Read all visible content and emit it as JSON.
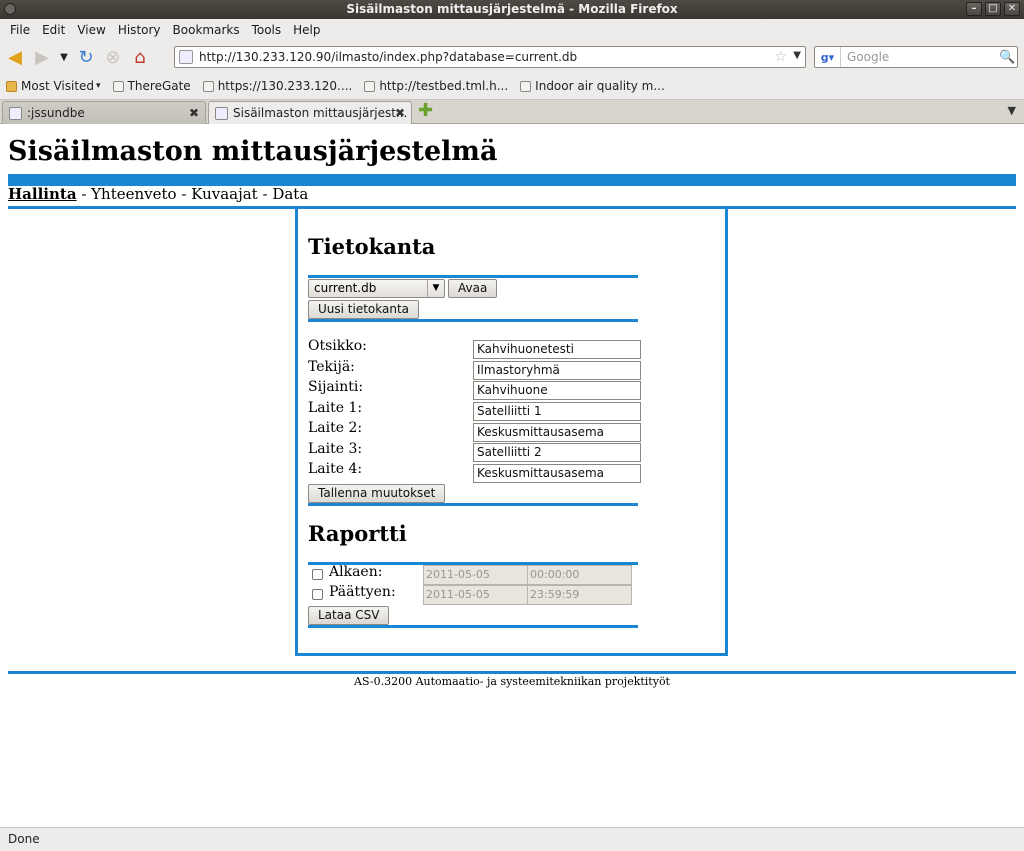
{
  "window": {
    "title": "Sisäilmaston mittausjärjestelmä - Mozilla Firefox"
  },
  "menu": [
    "File",
    "Edit",
    "View",
    "History",
    "Bookmarks",
    "Tools",
    "Help"
  ],
  "navigation": {
    "url": "http://130.233.120.90/ilmasto/index.php?database=current.db",
    "search_placeholder": "Google"
  },
  "bookmarks": [
    "Most Visited",
    "ThereGate",
    "https://130.233.120....",
    "http://testbed.tml.h...",
    "Indoor air quality m..."
  ],
  "tabs": [
    {
      "label": ":jssundbe"
    },
    {
      "label": "Sisäilmaston mittausjärjest..."
    }
  ],
  "page": {
    "title": "Sisäilmaston mittausjärjestelmä",
    "nav": {
      "current": "Hallinta",
      "items": [
        "Yhteenveto",
        "Kuvaajat",
        "Data"
      ],
      "separator": " - "
    },
    "database": {
      "heading": "Tietokanta",
      "selected": "current.db",
      "open_button": "Avaa",
      "new_button": "Uusi tietokanta"
    },
    "fields": [
      {
        "label": "Otsikko:",
        "value": "Kahvihuonetesti"
      },
      {
        "label": "Tekijä:",
        "value": "Ilmastoryhmä"
      },
      {
        "label": "Sijainti:",
        "value": "Kahvihuone"
      },
      {
        "label": "Laite 1:",
        "value": "Satelliitti 1"
      },
      {
        "label": "Laite 2:",
        "value": "Keskusmittausasema"
      },
      {
        "label": "Laite 3:",
        "value": "Satelliitti 2"
      },
      {
        "label": "Laite 4:",
        "value": "Keskusmittausasema"
      }
    ],
    "save_button": "Tallenna muutokset",
    "report": {
      "heading": "Raportti",
      "start_label": "Alkaen:",
      "start_date": "2011-05-05",
      "start_time": "00:00:00",
      "end_label": "Päättyen:",
      "end_date": "2011-05-05",
      "end_time": "23:59:59",
      "csv_button": "Lataa CSV"
    },
    "footer": "AS-0.3200 Automaatio- ja systeemitekniikan projektityöt"
  },
  "status": "Done",
  "colors": {
    "accent": "#1a86d4",
    "chrome": "#edeceb"
  }
}
